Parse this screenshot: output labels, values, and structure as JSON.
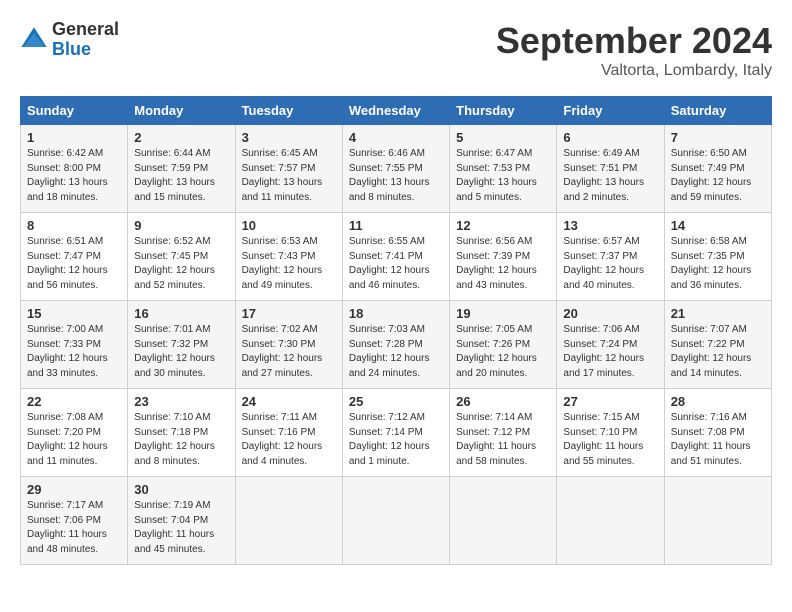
{
  "logo": {
    "general": "General",
    "blue": "Blue"
  },
  "title": "September 2024",
  "location": "Valtorta, Lombardy, Italy",
  "weekdays": [
    "Sunday",
    "Monday",
    "Tuesday",
    "Wednesday",
    "Thursday",
    "Friday",
    "Saturday"
  ],
  "weeks": [
    [
      {
        "day": "1",
        "sunrise": "Sunrise: 6:42 AM",
        "sunset": "Sunset: 8:00 PM",
        "daylight": "Daylight: 13 hours and 18 minutes."
      },
      {
        "day": "2",
        "sunrise": "Sunrise: 6:44 AM",
        "sunset": "Sunset: 7:59 PM",
        "daylight": "Daylight: 13 hours and 15 minutes."
      },
      {
        "day": "3",
        "sunrise": "Sunrise: 6:45 AM",
        "sunset": "Sunset: 7:57 PM",
        "daylight": "Daylight: 13 hours and 11 minutes."
      },
      {
        "day": "4",
        "sunrise": "Sunrise: 6:46 AM",
        "sunset": "Sunset: 7:55 PM",
        "daylight": "Daylight: 13 hours and 8 minutes."
      },
      {
        "day": "5",
        "sunrise": "Sunrise: 6:47 AM",
        "sunset": "Sunset: 7:53 PM",
        "daylight": "Daylight: 13 hours and 5 minutes."
      },
      {
        "day": "6",
        "sunrise": "Sunrise: 6:49 AM",
        "sunset": "Sunset: 7:51 PM",
        "daylight": "Daylight: 13 hours and 2 minutes."
      },
      {
        "day": "7",
        "sunrise": "Sunrise: 6:50 AM",
        "sunset": "Sunset: 7:49 PM",
        "daylight": "Daylight: 12 hours and 59 minutes."
      }
    ],
    [
      {
        "day": "8",
        "sunrise": "Sunrise: 6:51 AM",
        "sunset": "Sunset: 7:47 PM",
        "daylight": "Daylight: 12 hours and 56 minutes."
      },
      {
        "day": "9",
        "sunrise": "Sunrise: 6:52 AM",
        "sunset": "Sunset: 7:45 PM",
        "daylight": "Daylight: 12 hours and 52 minutes."
      },
      {
        "day": "10",
        "sunrise": "Sunrise: 6:53 AM",
        "sunset": "Sunset: 7:43 PM",
        "daylight": "Daylight: 12 hours and 49 minutes."
      },
      {
        "day": "11",
        "sunrise": "Sunrise: 6:55 AM",
        "sunset": "Sunset: 7:41 PM",
        "daylight": "Daylight: 12 hours and 46 minutes."
      },
      {
        "day": "12",
        "sunrise": "Sunrise: 6:56 AM",
        "sunset": "Sunset: 7:39 PM",
        "daylight": "Daylight: 12 hours and 43 minutes."
      },
      {
        "day": "13",
        "sunrise": "Sunrise: 6:57 AM",
        "sunset": "Sunset: 7:37 PM",
        "daylight": "Daylight: 12 hours and 40 minutes."
      },
      {
        "day": "14",
        "sunrise": "Sunrise: 6:58 AM",
        "sunset": "Sunset: 7:35 PM",
        "daylight": "Daylight: 12 hours and 36 minutes."
      }
    ],
    [
      {
        "day": "15",
        "sunrise": "Sunrise: 7:00 AM",
        "sunset": "Sunset: 7:33 PM",
        "daylight": "Daylight: 12 hours and 33 minutes."
      },
      {
        "day": "16",
        "sunrise": "Sunrise: 7:01 AM",
        "sunset": "Sunset: 7:32 PM",
        "daylight": "Daylight: 12 hours and 30 minutes."
      },
      {
        "day": "17",
        "sunrise": "Sunrise: 7:02 AM",
        "sunset": "Sunset: 7:30 PM",
        "daylight": "Daylight: 12 hours and 27 minutes."
      },
      {
        "day": "18",
        "sunrise": "Sunrise: 7:03 AM",
        "sunset": "Sunset: 7:28 PM",
        "daylight": "Daylight: 12 hours and 24 minutes."
      },
      {
        "day": "19",
        "sunrise": "Sunrise: 7:05 AM",
        "sunset": "Sunset: 7:26 PM",
        "daylight": "Daylight: 12 hours and 20 minutes."
      },
      {
        "day": "20",
        "sunrise": "Sunrise: 7:06 AM",
        "sunset": "Sunset: 7:24 PM",
        "daylight": "Daylight: 12 hours and 17 minutes."
      },
      {
        "day": "21",
        "sunrise": "Sunrise: 7:07 AM",
        "sunset": "Sunset: 7:22 PM",
        "daylight": "Daylight: 12 hours and 14 minutes."
      }
    ],
    [
      {
        "day": "22",
        "sunrise": "Sunrise: 7:08 AM",
        "sunset": "Sunset: 7:20 PM",
        "daylight": "Daylight: 12 hours and 11 minutes."
      },
      {
        "day": "23",
        "sunrise": "Sunrise: 7:10 AM",
        "sunset": "Sunset: 7:18 PM",
        "daylight": "Daylight: 12 hours and 8 minutes."
      },
      {
        "day": "24",
        "sunrise": "Sunrise: 7:11 AM",
        "sunset": "Sunset: 7:16 PM",
        "daylight": "Daylight: 12 hours and 4 minutes."
      },
      {
        "day": "25",
        "sunrise": "Sunrise: 7:12 AM",
        "sunset": "Sunset: 7:14 PM",
        "daylight": "Daylight: 12 hours and 1 minute."
      },
      {
        "day": "26",
        "sunrise": "Sunrise: 7:14 AM",
        "sunset": "Sunset: 7:12 PM",
        "daylight": "Daylight: 11 hours and 58 minutes."
      },
      {
        "day": "27",
        "sunrise": "Sunrise: 7:15 AM",
        "sunset": "Sunset: 7:10 PM",
        "daylight": "Daylight: 11 hours and 55 minutes."
      },
      {
        "day": "28",
        "sunrise": "Sunrise: 7:16 AM",
        "sunset": "Sunset: 7:08 PM",
        "daylight": "Daylight: 11 hours and 51 minutes."
      }
    ],
    [
      {
        "day": "29",
        "sunrise": "Sunrise: 7:17 AM",
        "sunset": "Sunset: 7:06 PM",
        "daylight": "Daylight: 11 hours and 48 minutes."
      },
      {
        "day": "30",
        "sunrise": "Sunrise: 7:19 AM",
        "sunset": "Sunset: 7:04 PM",
        "daylight": "Daylight: 11 hours and 45 minutes."
      },
      null,
      null,
      null,
      null,
      null
    ]
  ]
}
